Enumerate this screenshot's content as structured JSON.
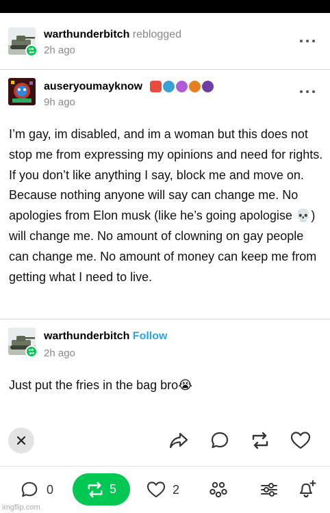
{
  "reblogger": {
    "username": "warthunderbitch",
    "action": "reblogged",
    "time": "2h ago"
  },
  "original_post": {
    "username": "auseryoumayknow",
    "time": "9h ago",
    "badge_icons": [
      "red-shield-badge",
      "blue-dragon-badge",
      "purple-monster-badge",
      "orange-creature-badge",
      "dark-creature-badge"
    ],
    "body_part1": "I’m gay, im disabled, and im a woman but this does not stop me from expressing my opinions and need for rights. If you don’t like anything I say, block me and move on. Because nothing anyone will say can change me. No apologies from Elon musk (like he’s going apologise ",
    "body_emoji": "💀",
    "body_part2": ") will change me. No amount of clowning on gay people can change me. No amount of money can keep me from getting what I need to live."
  },
  "reply_post": {
    "username": "warthunderbitch",
    "follow_label": "Follow",
    "time": "2h ago",
    "body": "Just put the fries in the bag bro",
    "body_emoji": "😭"
  },
  "bottom_bar": {
    "replies_count": "0",
    "reblogs_count": "5",
    "likes_count": "2"
  },
  "watermark": "imgflip.com",
  "colors": {
    "reblog_green": "#00c853",
    "follow_blue": "#2aa6e6",
    "muted_gray": "#888888"
  }
}
